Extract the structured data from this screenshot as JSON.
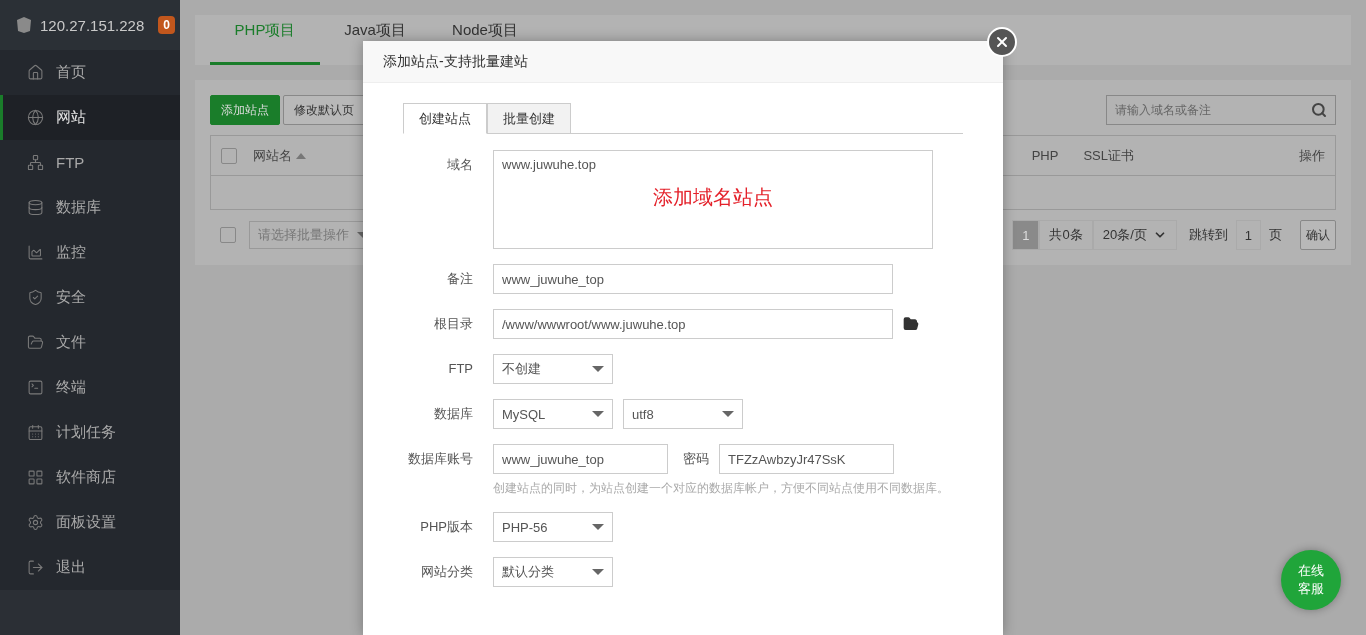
{
  "server": {
    "ip": "120.27.151.228",
    "badge": "0"
  },
  "sidebar": {
    "items": [
      {
        "label": "首页",
        "selected": false
      },
      {
        "label": "网站",
        "selected": true
      },
      {
        "label": "FTP",
        "selected": false
      },
      {
        "label": "数据库",
        "selected": false
      },
      {
        "label": "监控",
        "selected": false
      },
      {
        "label": "安全",
        "selected": false
      },
      {
        "label": "文件",
        "selected": false
      },
      {
        "label": "终端",
        "selected": false
      },
      {
        "label": "计划任务",
        "selected": false
      },
      {
        "label": "软件商店",
        "selected": false
      },
      {
        "label": "面板设置",
        "selected": false
      },
      {
        "label": "退出",
        "selected": false
      }
    ]
  },
  "project_tabs": [
    {
      "label": "PHP项目",
      "selected": true
    },
    {
      "label": "Java项目",
      "selected": false
    },
    {
      "label": "Node项目",
      "selected": false
    }
  ],
  "toolbar": {
    "buttons": [
      {
        "label": "添加站点",
        "primary": true
      },
      {
        "label": "修改默认页",
        "primary": false
      }
    ],
    "search": {
      "placeholder": "请输入域名或备注"
    }
  },
  "table": {
    "select_all": {
      "checked": false
    },
    "columns": [
      {
        "label": "网站名",
        "sorted": true
      },
      {
        "label": "PHP",
        "sorted": false
      },
      {
        "label": "SSL证书",
        "sorted": false
      },
      {
        "label": "操作",
        "sorted": false
      }
    ]
  },
  "footer": {
    "checkbox": {
      "checked": false
    },
    "batch_select": {
      "placeholder": "请选择批量操作"
    },
    "pagination": {
      "pages": [
        {
          "label": "1",
          "selected": true
        }
      ],
      "total": "共0条",
      "page_size": "20条/页",
      "jump_label": "跳转到",
      "jump_value": "1",
      "page_unit": "页",
      "confirm": "确认"
    }
  },
  "dialog": {
    "title": "添加站点-支持批量建站",
    "tabs": [
      {
        "label": "创建站点",
        "selected": true
      },
      {
        "label": "批量创建",
        "selected": false
      }
    ],
    "rows": [
      {
        "kind": "textarea",
        "label": "域名",
        "value": "www.juwuhe.top",
        "hint": "添加域名站点"
      },
      {
        "kind": "text",
        "label": "备注",
        "value": "www_juwuhe_top"
      },
      {
        "kind": "path",
        "label": "根目录",
        "value": "/www/wwwroot/www.juwuhe.top"
      },
      {
        "kind": "select",
        "label": "FTP",
        "values": [
          "不创建"
        ]
      },
      {
        "kind": "select",
        "label": "数据库",
        "values": [
          "MySQL",
          "utf8"
        ]
      },
      {
        "kind": "account",
        "label": "数据库账号",
        "value": "www_juwuhe_top",
        "password_label": "密码",
        "password_value": "TFZzAwbzyJr47SsK",
        "note": "创建站点的同时，为站点创建一个对应的数据库帐户，方便不同站点使用不同数据库。"
      },
      {
        "kind": "select",
        "label": "PHP版本",
        "values": [
          "PHP-56"
        ]
      },
      {
        "kind": "select",
        "label": "网站分类",
        "values": [
          "默认分类"
        ]
      }
    ]
  },
  "chat_button": {
    "lines": [
      "在线",
      "客服"
    ]
  }
}
